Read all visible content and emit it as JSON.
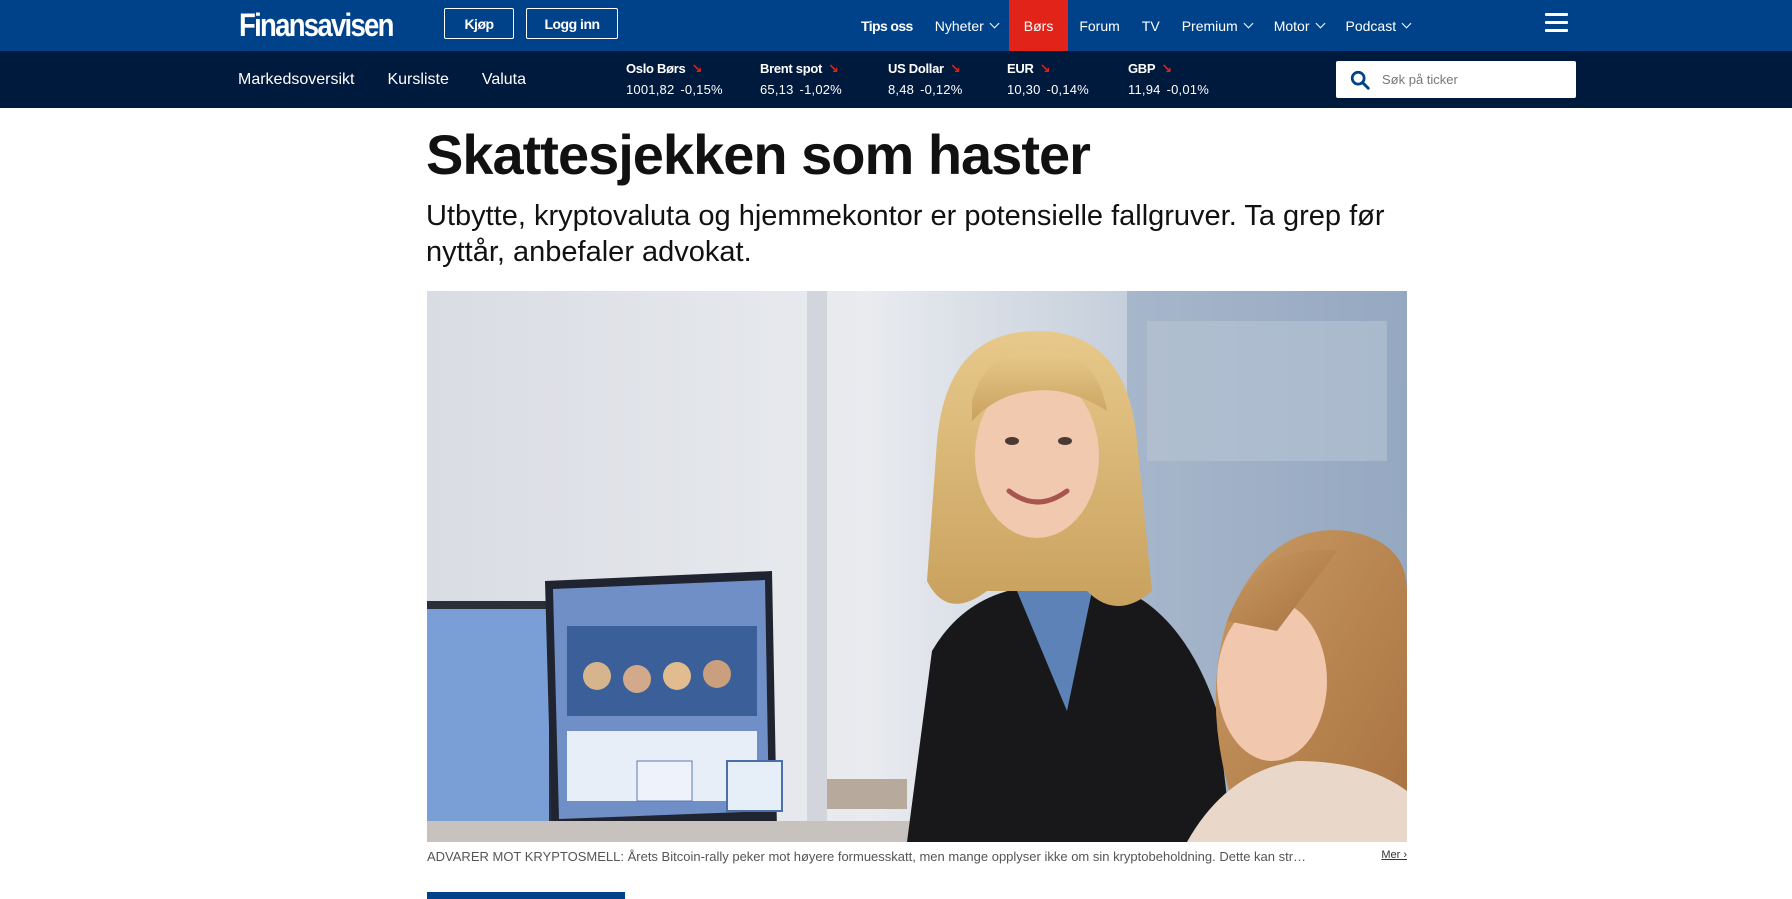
{
  "header": {
    "logo": "Finansavisen",
    "buy_label": "Kjøp",
    "login_label": "Logg inn",
    "nav": [
      {
        "label": "Tips oss",
        "dropdown": false
      },
      {
        "label": "Nyheter",
        "dropdown": true
      },
      {
        "label": "Børs",
        "dropdown": false,
        "active": true
      },
      {
        "label": "Forum",
        "dropdown": false
      },
      {
        "label": "TV",
        "dropdown": false
      },
      {
        "label": "Premium",
        "dropdown": true
      },
      {
        "label": "Motor",
        "dropdown": true
      },
      {
        "label": "Podcast",
        "dropdown": true
      }
    ],
    "menu_icon": "hamburger-icon"
  },
  "market": {
    "links": [
      "Markedsoversikt",
      "Kursliste",
      "Valuta"
    ],
    "tickers": [
      {
        "name": "Oslo Børs",
        "value": "1001,82",
        "change": "-0,15%",
        "direction": "down"
      },
      {
        "name": "Brent spot",
        "value": "65,13",
        "change": "-1,02%",
        "direction": "down"
      },
      {
        "name": "US Dollar",
        "value": "8,48",
        "change": "-0,12%",
        "direction": "down"
      },
      {
        "name": "EUR",
        "value": "10,30",
        "change": "-0,14%",
        "direction": "down"
      },
      {
        "name": "GBP",
        "value": "11,94",
        "change": "-0,01%",
        "direction": "down"
      }
    ],
    "search": {
      "placeholder": "Søk på ticker",
      "icon": "search-icon"
    }
  },
  "article": {
    "headline": "Skattesjekken som haster",
    "lead": "Utbytte, kryptovaluta og hjemmekontor er potensielle fallgruver. Ta grep før nyttår, anbefaler advokat.",
    "caption": "ADVARER MOT KRYPTOSMELL: Årets Bitcoin-rally peker mot høyere formuesskatt, men mange opplyser ikke om sin kryptobeholdning. Dette kan str…",
    "caption_more": "Mer ›"
  },
  "colors": {
    "brand_blue": "#004289",
    "market_bar": "#001a3d",
    "active_red": "#e2231a"
  }
}
